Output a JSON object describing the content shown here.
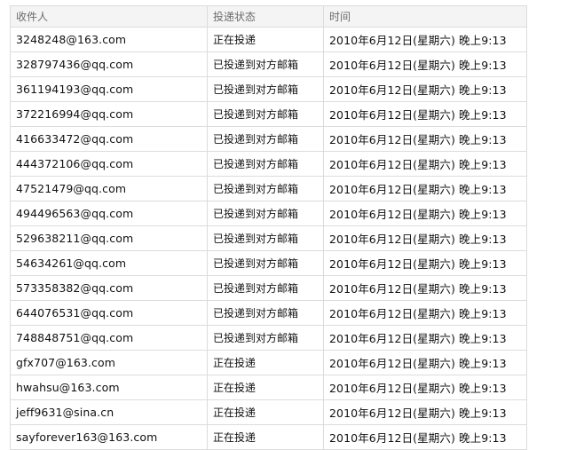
{
  "table": {
    "headers": {
      "recipient": "收件人",
      "status": "投递状态",
      "time": "时间"
    },
    "rows": [
      {
        "recipient": "3248248@163.com",
        "status": "正在投递",
        "time": "2010年6月12日(星期六) 晚上9:13"
      },
      {
        "recipient": "328797436@qq.com",
        "status": "已投递到对方邮箱",
        "time": "2010年6月12日(星期六) 晚上9:13"
      },
      {
        "recipient": "361194193@qq.com",
        "status": "已投递到对方邮箱",
        "time": "2010年6月12日(星期六) 晚上9:13"
      },
      {
        "recipient": "372216994@qq.com",
        "status": "已投递到对方邮箱",
        "time": "2010年6月12日(星期六) 晚上9:13"
      },
      {
        "recipient": "416633472@qq.com",
        "status": "已投递到对方邮箱",
        "time": "2010年6月12日(星期六) 晚上9:13"
      },
      {
        "recipient": "444372106@qq.com",
        "status": "已投递到对方邮箱",
        "time": "2010年6月12日(星期六) 晚上9:13"
      },
      {
        "recipient": "47521479@qq.com",
        "status": "已投递到对方邮箱",
        "time": "2010年6月12日(星期六) 晚上9:13"
      },
      {
        "recipient": "494496563@qq.com",
        "status": "已投递到对方邮箱",
        "time": "2010年6月12日(星期六) 晚上9:13"
      },
      {
        "recipient": "529638211@qq.com",
        "status": "已投递到对方邮箱",
        "time": "2010年6月12日(星期六) 晚上9:13"
      },
      {
        "recipient": "54634261@qq.com",
        "status": "已投递到对方邮箱",
        "time": "2010年6月12日(星期六) 晚上9:13"
      },
      {
        "recipient": "573358382@qq.com",
        "status": "已投递到对方邮箱",
        "time": "2010年6月12日(星期六) 晚上9:13"
      },
      {
        "recipient": "644076531@qq.com",
        "status": "已投递到对方邮箱",
        "time": "2010年6月12日(星期六) 晚上9:13"
      },
      {
        "recipient": "748848751@qq.com",
        "status": "已投递到对方邮箱",
        "time": "2010年6月12日(星期六) 晚上9:13"
      },
      {
        "recipient": "gfx707@163.com",
        "status": "正在投递",
        "time": "2010年6月12日(星期六) 晚上9:13"
      },
      {
        "recipient": "hwahsu@163.com",
        "status": "正在投递",
        "time": "2010年6月12日(星期六) 晚上9:13"
      },
      {
        "recipient": "jeff9631@sina.cn",
        "status": "正在投递",
        "time": "2010年6月12日(星期六) 晚上9:13"
      },
      {
        "recipient": "sayforever163@163.com",
        "status": "正在投递",
        "time": "2010年6月12日(星期六) 晚上9:13"
      }
    ]
  },
  "colors": {
    "header_background": "#f4f4f4",
    "header_text": "#6b6b6b",
    "border": "#dcdcdc",
    "text": "#111111"
  }
}
